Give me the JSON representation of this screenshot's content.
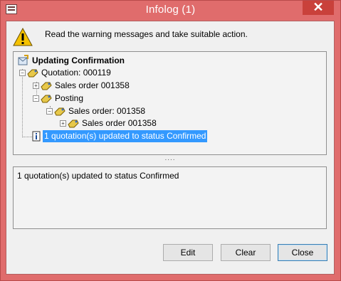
{
  "window": {
    "title": "Infolog (1)",
    "close_glyph": "✕"
  },
  "instructions": "Read the warning messages and take suitable action.",
  "tree": {
    "items": [
      {
        "label": "Updating Confirmation",
        "icon": "infolog-header-icon"
      },
      {
        "label": "Quotation: 000119",
        "icon": "key-icon"
      },
      {
        "label": "Sales order 001358",
        "icon": "key-icon"
      },
      {
        "label": "Posting",
        "icon": "key-icon"
      },
      {
        "label": "Sales order: 001358",
        "icon": "key-icon"
      },
      {
        "label": "Sales order 001358",
        "icon": "key-icon"
      },
      {
        "label": "1 quotation(s) updated to status Confirmed",
        "icon": "info-icon"
      }
    ]
  },
  "splitter_glyph": "....",
  "message": "1 quotation(s) updated to status Confirmed",
  "buttons": {
    "edit": "Edit",
    "clear": "Clear",
    "close": "Close"
  },
  "colors": {
    "frame": "#e06c6c",
    "selection": "#3399ff",
    "close_button": "#c9413b"
  }
}
